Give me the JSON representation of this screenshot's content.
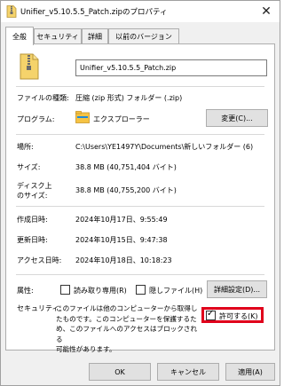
{
  "window": {
    "title": "Unifier_v5.10.5.5_Patch.zipのプロパティ",
    "close_glyph": "✕"
  },
  "tabs": [
    {
      "label": "全般",
      "active": true
    },
    {
      "label": "セキュリティ",
      "active": false
    },
    {
      "label": "詳細",
      "active": false
    },
    {
      "label": "以前のバージョン",
      "active": false
    }
  ],
  "general": {
    "file_name": "Unifier_v5.10.5.5_Patch.zip",
    "file_type_label": "ファイルの種類:",
    "file_type_value": "圧縮 (zip 形式) フォルダー (.zip)",
    "program_label": "プログラム:",
    "program_value": "エクスプローラー",
    "change_button": "変更(C)...",
    "location_label": "場所:",
    "location_value": "C:\\Users\\YE1497Y\\Documents\\新しいフォルダー (6)",
    "size_label": "サイズ:",
    "size_value": "38.8 MB (40,751,404 バイト)",
    "disk_size_label_1": "ディスク上",
    "disk_size_label_2": "のサイズ:",
    "disk_size_value": "38.8 MB (40,755,200 バイト)",
    "created_label": "作成日時:",
    "created_value": "2024年10月17日、9:55:49",
    "modified_label": "更新日時:",
    "modified_value": "2024年10月15日、9:47:38",
    "accessed_label": "アクセス日時:",
    "accessed_value": "2024年10月18日、10:18:23",
    "attributes_label": "属性:",
    "readonly_label": "読み取り専用(R)",
    "hidden_label": "隠しファイル(H)",
    "advanced_button": "詳細設定(D)...",
    "security_label": "セキュリティ:",
    "security_line_1": "このファイルは他のコンピューターから取得し",
    "security_line_2": "たものです。このコンピューターを保護するた",
    "security_line_3": "め、このファイルへのアクセスはブロックされる",
    "security_line_4": "可能性があります。",
    "unblock_label": "許可する(K)",
    "unblock_checked": true
  },
  "footer": {
    "ok": "OK",
    "cancel": "キャンセル",
    "apply": "適用(A)"
  },
  "colors": {
    "highlight": "#e0001b",
    "window_bg": "#f0f0f0"
  }
}
